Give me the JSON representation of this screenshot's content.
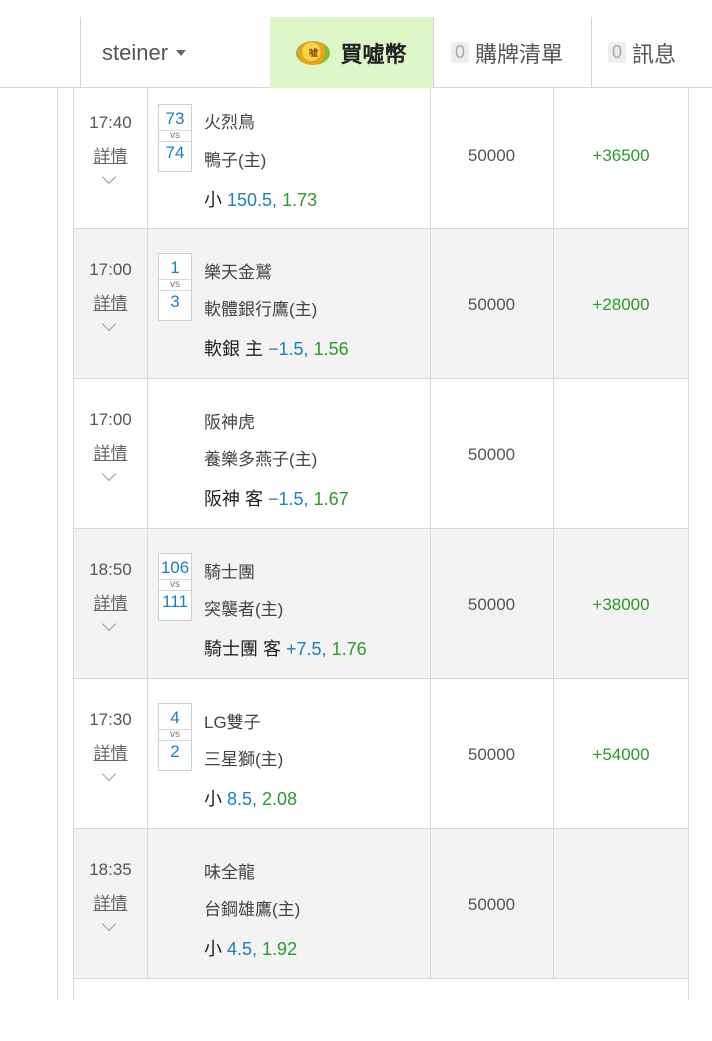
{
  "header": {
    "username": "steiner",
    "buy_label": "買噓幣",
    "coin_glyph": "噓",
    "cart_count": "0",
    "cart_label": "購牌清單",
    "msg_count": "0",
    "msg_label": "訊息"
  },
  "colors": {
    "link": "#1a7fbf",
    "win": "#2a9a2a",
    "buy_bg": "#ddf7c8"
  },
  "rows": [
    {
      "time": "17:40",
      "detail": "詳情",
      "score1": "73",
      "score2": "74",
      "vs": "vs",
      "team1": "火烈鳥",
      "team2": "鴨子(主)",
      "bet_pick": "小 ",
      "bet_line": "150.5,",
      "bet_odds": " 1.73",
      "stake": "50000",
      "result": "+36500"
    },
    {
      "time": "17:00",
      "detail": "詳情",
      "score1": "1",
      "score2": "3",
      "vs": "vs",
      "team1": "樂天金鷲",
      "team2": "軟體銀行鷹(主)",
      "bet_pick": "軟銀 主 ",
      "bet_line": "−1.5,",
      "bet_odds": " 1.56",
      "stake": "50000",
      "result": "+28000"
    },
    {
      "time": "17:00",
      "detail": "詳情",
      "score1": "",
      "score2": "",
      "vs": "",
      "team1": "阪神虎",
      "team2": "養樂多燕子(主)",
      "bet_pick": "阪神 客 ",
      "bet_line": "−1.5,",
      "bet_odds": " 1.67",
      "stake": "50000",
      "result": ""
    },
    {
      "time": "18:50",
      "detail": "詳情",
      "score1": "106",
      "score2": "111",
      "vs": "vs",
      "team1": "騎士團",
      "team2": "突襲者(主)",
      "bet_pick": "騎士團 客 ",
      "bet_line": "+7.5,",
      "bet_odds": " 1.76",
      "stake": "50000",
      "result": "+38000"
    },
    {
      "time": "17:30",
      "detail": "詳情",
      "score1": "4",
      "score2": "2",
      "vs": "vs",
      "team1": "LG雙子",
      "team2": "三星獅(主)",
      "bet_pick": "小 ",
      "bet_line": "8.5,",
      "bet_odds": " 2.08",
      "stake": "50000",
      "result": "+54000"
    },
    {
      "time": "18:35",
      "detail": "詳情",
      "score1": "",
      "score2": "",
      "vs": "",
      "team1": "味全龍",
      "team2": "台鋼雄鷹(主)",
      "bet_pick": "小 ",
      "bet_line": "4.5,",
      "bet_odds": " 1.92",
      "stake": "50000",
      "result": ""
    }
  ]
}
